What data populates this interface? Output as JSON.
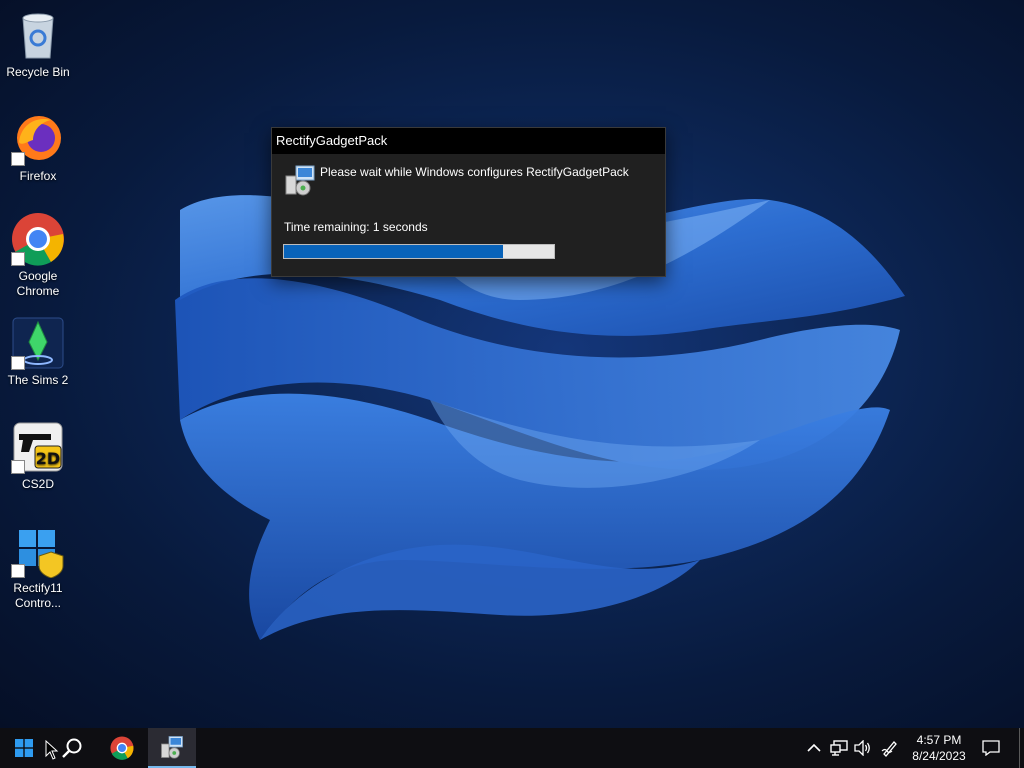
{
  "desktop": {
    "icons": [
      {
        "label": "Recycle Bin"
      },
      {
        "label": "Firefox"
      },
      {
        "label": "Google Chrome"
      },
      {
        "label": "The Sims 2"
      },
      {
        "label": "CS2D"
      },
      {
        "label": "Rectify11 Contro..."
      }
    ]
  },
  "dialog": {
    "title": "RectifyGadgetPack",
    "message": "Please wait while Windows configures RectifyGadgetPack",
    "time_remaining": "Time remaining: 1 seconds",
    "progress_fraction": 0.81
  },
  "taskbar": {
    "clock_time": "4:57 PM",
    "clock_date": "8/24/2023"
  },
  "colors": {
    "accent": "#0963b9",
    "dialog_bg": "#202020",
    "titlebar_bg": "#000000",
    "taskbar_bg": "#0e0e12"
  }
}
